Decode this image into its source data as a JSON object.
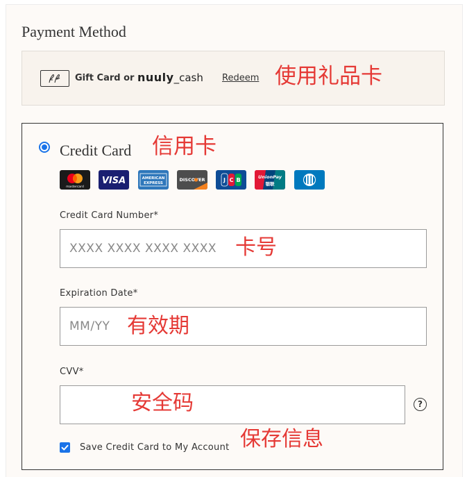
{
  "section": {
    "title": "Payment Method"
  },
  "gift_card": {
    "text": "Gift Card or",
    "brand": "nuuly",
    "brand_suffix": "_cash",
    "redeem_label": "Redeem",
    "annotation": "使用礼品卡"
  },
  "credit_card": {
    "label": "Credit Card",
    "selected": true,
    "annotation": "信用卡",
    "card_brands": [
      {
        "name": "mastercard",
        "label": "mastercard"
      },
      {
        "name": "visa",
        "label": "VISA"
      },
      {
        "name": "american-express",
        "label": "AMERICAN EXPRESS"
      },
      {
        "name": "discover",
        "label": "DISCOVER"
      },
      {
        "name": "jcb",
        "label": "JCB"
      },
      {
        "name": "unionpay",
        "label": "UnionPay 银联"
      },
      {
        "name": "diners-club",
        "label": ""
      }
    ]
  },
  "fields": {
    "number": {
      "label": "Credit Card Number*",
      "placeholder": "XXXX XXXX XXXX XXXX",
      "value": "",
      "annotation": "卡号"
    },
    "expiry": {
      "label": "Expiration Date*",
      "placeholder": "MM/YY",
      "value": "",
      "annotation": "有效期"
    },
    "cvv": {
      "label": "CVV*",
      "placeholder": "",
      "value": "",
      "annotation": "安全码",
      "help_glyph": "?"
    }
  },
  "save_card": {
    "label": "Save Credit Card to My Account",
    "checked": true,
    "annotation": "保存信息"
  },
  "colors": {
    "accent": "#1a73e8",
    "annotation": "#e53935",
    "panel_bg": "#fdfaf7",
    "gift_bg": "#f8f3ed"
  }
}
